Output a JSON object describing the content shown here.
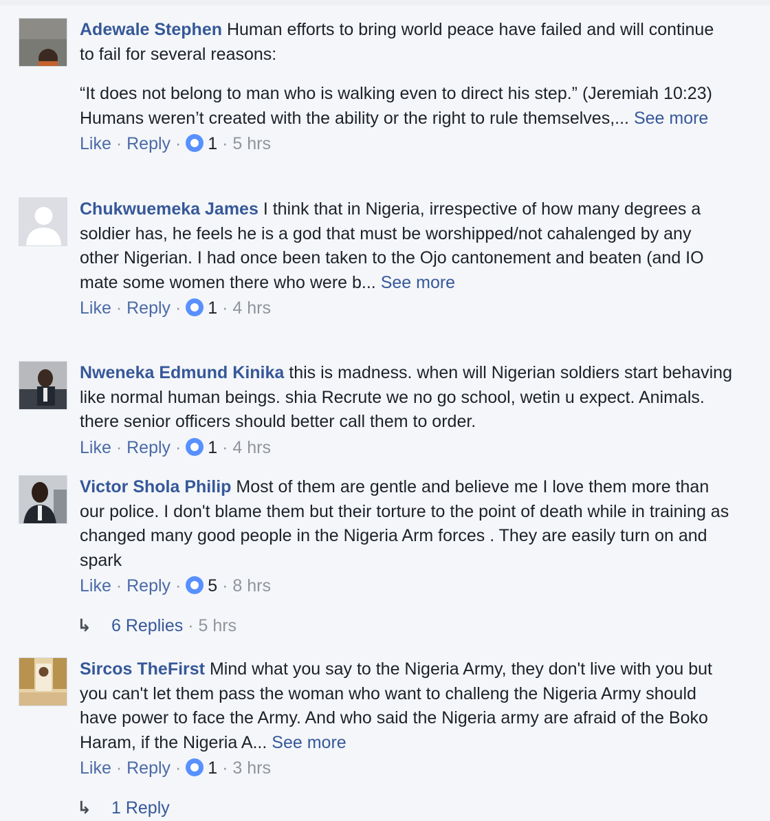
{
  "comments": [
    {
      "author": "Adewale Stephen",
      "text": "Human efforts to bring world peace have failed and will continue to fail for several reasons:",
      "text2": "“It does not belong to man who is walking even to direct his step.” (Jeremiah 10:23) Humans weren’t created with the ability or the right to rule themselves,...",
      "see_more": "See more",
      "like": "Like",
      "reply": "Reply",
      "reactions": "1",
      "time": "5 hrs"
    },
    {
      "author": "Chukwuemeka James",
      "text": "I think that in Nigeria, irrespective of how many degrees a soldier has, he feels he is a god that must be worshipped/not cahalenged by any other Nigerian. I had once been taken to the Ojo cantonement and beaten (and IO mate some women there who were b...",
      "see_more": "See more",
      "like": "Like",
      "reply": "Reply",
      "reactions": "1",
      "time": "4 hrs"
    },
    {
      "author": "Nweneka Edmund Kinika",
      "text": "this is madness. when will Nigerian soldiers start behaving like normal human beings. shia Recrute we no go school, wetin u expect. Animals. there senior officers should better call them to order.",
      "like": "Like",
      "reply": "Reply",
      "reactions": "1",
      "time": "4 hrs"
    },
    {
      "author": "Victor Shola Philip",
      "text": "Most of them are gentle and believe me I love them more than our police. I don't blame them but their torture to the point of death while in training as changed many good people in the Nigeria Arm forces . They are easily turn on and spark",
      "like": "Like",
      "reply": "Reply",
      "reactions": "5",
      "time": "8 hrs",
      "replies_label": "6 Replies",
      "replies_time": "5 hrs"
    },
    {
      "author": "Sircos TheFirst",
      "text": "Mind what you say to the Nigeria Army, they don't live with you but you can't let them pass the woman who want to challeng the Nigeria Army should have power to face the Army. And who said the Nigeria army are afraid of the Boko Haram, if the Nigeria A...",
      "see_more": "See more",
      "like": "Like",
      "reply": "Reply",
      "reactions": "1",
      "time": "3 hrs",
      "replies_label": "1 Reply"
    }
  ],
  "icons": {
    "avatar": "user-avatar",
    "reaction": "like-reaction-icon",
    "reply_arrow": "reply-arrow-icon"
  },
  "colors": {
    "name": "#365899",
    "reaction": "#5890ff",
    "meta": "#90949c",
    "background": "#f4f6f9"
  }
}
